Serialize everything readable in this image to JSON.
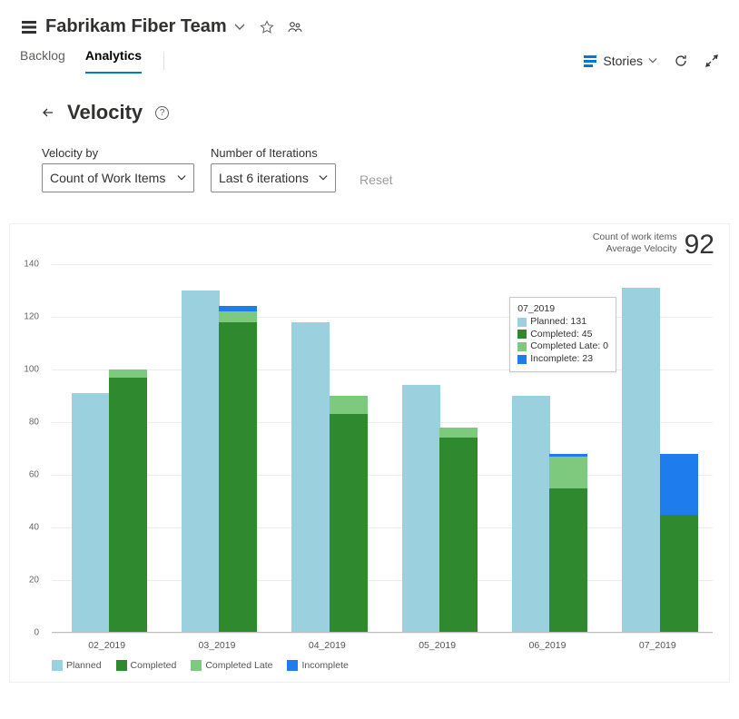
{
  "header": {
    "team_name": "Fabrikam Fiber Team"
  },
  "tabs": {
    "backlog": "Backlog",
    "analytics": "Analytics"
  },
  "right_tools": {
    "stories_label": "Stories"
  },
  "page": {
    "title": "Velocity",
    "velocity_by_label": "Velocity by",
    "velocity_by_value": "Count of Work Items",
    "iterations_label": "Number of Iterations",
    "iterations_value": "Last 6 iterations",
    "reset_label": "Reset"
  },
  "metric": {
    "line1": "Count of work items",
    "line2": "Average Velocity",
    "value": "92"
  },
  "legend": {
    "planned": "Planned",
    "completed": "Completed",
    "late": "Completed Late",
    "incomplete": "Incomplete"
  },
  "tooltip": {
    "title": "07_2019",
    "planned": "Planned: 131",
    "completed": "Completed: 45",
    "late": "Completed Late: 0",
    "incomplete": "Incomplete: 23"
  },
  "chart_data": {
    "type": "bar",
    "title": "Velocity",
    "ylabel": "Count of work items",
    "xlabel": "",
    "ylim": [
      0,
      140
    ],
    "y_ticks": [
      0,
      20,
      40,
      60,
      80,
      100,
      120,
      140
    ],
    "categories": [
      "02_2019",
      "03_2019",
      "04_2019",
      "05_2019",
      "06_2019",
      "07_2019"
    ],
    "series": [
      {
        "name": "Planned",
        "values": [
          91,
          130,
          118,
          94,
          90,
          131
        ]
      },
      {
        "name": "Completed",
        "values": [
          97,
          118,
          83,
          74,
          55,
          45
        ]
      },
      {
        "name": "Completed Late",
        "values": [
          3,
          4,
          7,
          4,
          12,
          0
        ]
      },
      {
        "name": "Incomplete",
        "values": [
          0,
          2,
          0,
          0,
          1,
          23
        ]
      }
    ],
    "legend_position": "bottom-left",
    "grid": true,
    "average_velocity": 92
  }
}
